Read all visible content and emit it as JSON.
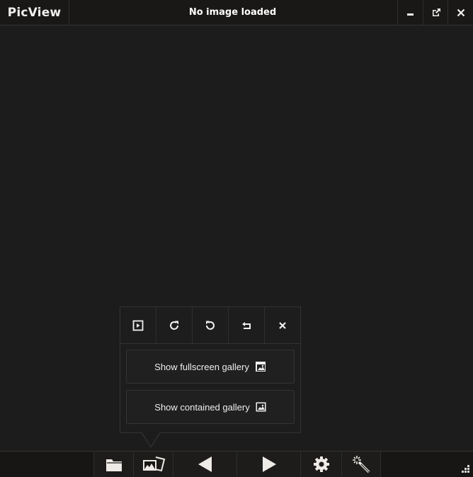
{
  "app": {
    "name": "PicView",
    "title": "No image loaded"
  },
  "window_controls": [
    {
      "name": "minimize-button",
      "icon": "minimize-icon"
    },
    {
      "name": "fullscreen-button",
      "icon": "external-window-icon"
    },
    {
      "name": "close-button",
      "icon": "close-icon"
    }
  ],
  "popup": {
    "tools": [
      {
        "icon": "slideshow-icon",
        "label": "Slideshow"
      },
      {
        "icon": "rotate-right-icon",
        "label": "Rotate right"
      },
      {
        "icon": "rotate-left-icon",
        "label": "Rotate left"
      },
      {
        "icon": "flip-icon",
        "label": "Flip"
      },
      {
        "icon": "close-icon",
        "label": "Close"
      }
    ],
    "buttons": {
      "fullscreen_gallery": "Show fullscreen gallery",
      "contained_gallery": "Show contained gallery"
    }
  },
  "bottombar": {
    "buttons": [
      {
        "icon": "folder-icon",
        "label": "Open file"
      },
      {
        "icon": "gallery-icon",
        "label": "Image menu"
      },
      {
        "icon": "previous-arrow-icon",
        "label": "Previous"
      },
      {
        "icon": "next-arrow-icon",
        "label": "Next"
      },
      {
        "icon": "gear-icon",
        "label": "Settings"
      },
      {
        "icon": "magic-wand-icon",
        "label": "Effects"
      }
    ]
  },
  "colors": {
    "background": "#1c1c1c",
    "bar": "#181614",
    "icon": "#f0f0f0"
  }
}
